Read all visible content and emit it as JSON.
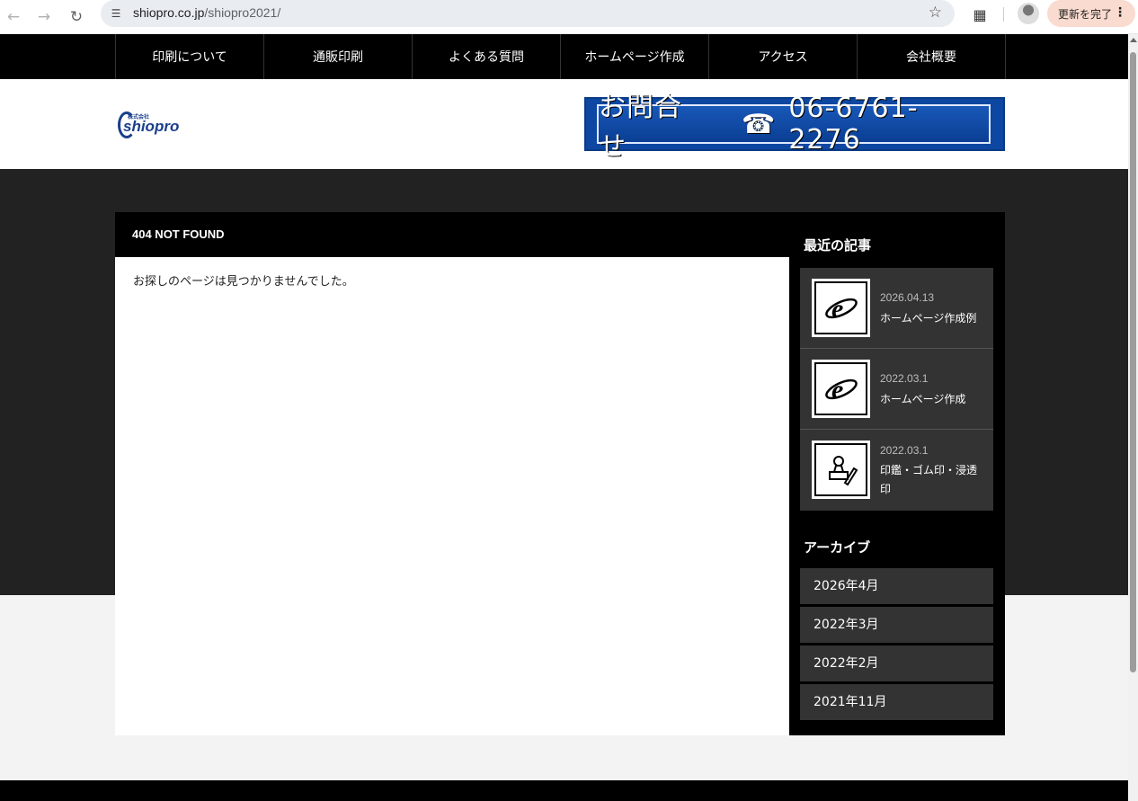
{
  "browser": {
    "url_host": "shiopro.co.jp",
    "url_path": "/shiopro2021/",
    "update_label": "更新を完了"
  },
  "nav": {
    "items": [
      {
        "label": "印刷について"
      },
      {
        "label": "通販印刷"
      },
      {
        "label": "よくある質問"
      },
      {
        "label": "ホームページ作成"
      },
      {
        "label": "アクセス"
      },
      {
        "label": "会社概要"
      }
    ]
  },
  "header": {
    "logo_small": "株式会社",
    "logo_text": "shiopro",
    "contact_label": "お問合せ",
    "contact_phone": "06-6761-2276"
  },
  "main": {
    "title": "404 NOT FOUND",
    "message": "お探しのページは見つかりませんでした。"
  },
  "sidebar": {
    "recent_heading": "最近の記事",
    "recent": [
      {
        "date": "2026.04.13",
        "title": "ホームページ作成例",
        "icon": "ie-icon"
      },
      {
        "date": "2022.03.1",
        "title": "ホームページ作成",
        "icon": "ie-icon"
      },
      {
        "date": "2022.03.1",
        "title": "印鑑・ゴム印・浸透印",
        "icon": "stamp-icon"
      }
    ],
    "archive_heading": "アーカイブ",
    "archives": [
      {
        "label": "2026年4月"
      },
      {
        "label": "2022年3月"
      },
      {
        "label": "2022年2月"
      },
      {
        "label": "2021年11月"
      }
    ]
  },
  "colors": {
    "nav_bg": "#000000",
    "dark_band": "#222222",
    "brand_blue": "#1a3f8a",
    "sidebar_item": "#333333"
  }
}
